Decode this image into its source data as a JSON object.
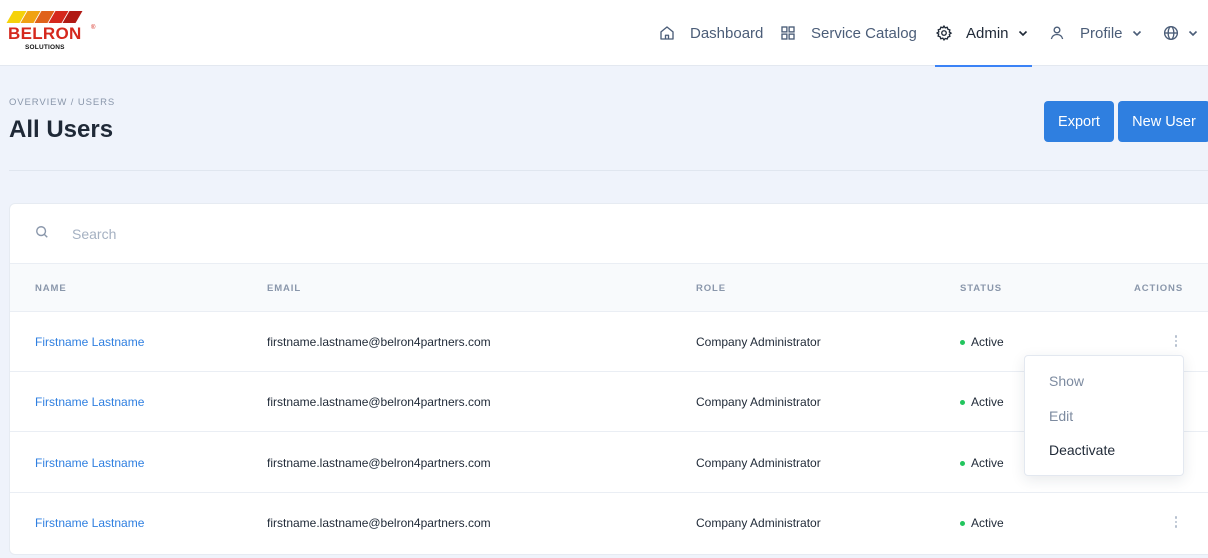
{
  "brand": {
    "name": "BELRON",
    "registered": "®",
    "sub": "SOLUTIONS",
    "colors": [
      "#f5d20a",
      "#f0a214",
      "#e0621b",
      "#d5281d",
      "#b01a14"
    ]
  },
  "nav": {
    "dashboard": {
      "label": "Dashboard",
      "icon": "home-icon"
    },
    "catalog": {
      "label": "Service Catalog",
      "icon": "grid-icon"
    },
    "admin": {
      "label": "Admin",
      "icon": "gear-icon"
    },
    "profile": {
      "label": "Profile",
      "icon": "user-icon"
    },
    "language": {
      "icon": "globe-icon"
    }
  },
  "page": {
    "breadcrumb": "OVERVIEW / USERS",
    "title": "All Users",
    "export_label": "Export",
    "new_user_label": "New User"
  },
  "search": {
    "placeholder": "Search",
    "value": ""
  },
  "table": {
    "headers": {
      "name": "NAME",
      "email": "EMAIL",
      "role": "ROLE",
      "status": "STATUS",
      "actions": "ACTIONS"
    },
    "rows": [
      {
        "name": "Firstname Lastname",
        "email": "firstname.lastname@belron4partners.com",
        "role": "Company Administrator",
        "status": "Active"
      },
      {
        "name": "Firstname Lastname",
        "email": "firstname.lastname@belron4partners.com",
        "role": "Company Administrator",
        "status": "Active"
      },
      {
        "name": "Firstname Lastname",
        "email": "firstname.lastname@belron4partners.com",
        "role": "Company Administrator",
        "status": "Active"
      },
      {
        "name": "Firstname Lastname",
        "email": "firstname.lastname@belron4partners.com",
        "role": "Company Administrator",
        "status": "Active"
      }
    ]
  },
  "actions_menu": {
    "show": "Show",
    "edit": "Edit",
    "deactivate": "Deactivate"
  },
  "colors": {
    "accent": "#2f7fe0",
    "status_active": "#22c55e",
    "brand_red": "#d5281d"
  }
}
